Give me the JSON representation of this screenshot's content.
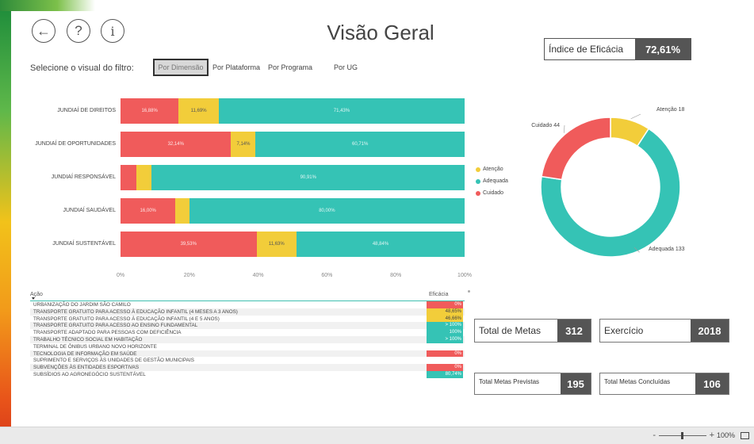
{
  "title": "Visão Geral",
  "nav": {
    "back_icon": "←",
    "help_icon": "?",
    "info_icon": "i"
  },
  "filter": {
    "label": "Selecione o visual do filtro:",
    "options": [
      "Por Dimensão",
      "Por Plataforma",
      "Por Programa",
      "Por UG"
    ],
    "selected": "Por Dimensão"
  },
  "eficacia": {
    "label": "Índice de Eficácia",
    "value": "72,61%"
  },
  "colors": {
    "atencao": "#f2cd3a",
    "adequada": "#35c3b5",
    "cuidado": "#f05b5b"
  },
  "chart_data": [
    {
      "type": "bar",
      "orientation": "horizontal-stacked-100",
      "categories": [
        "JUNDIAÍ DE DIREITOS",
        "JUNDIAÍ DE OPORTUNIDADES",
        "JUNDIAÍ RESPONSÁVEL",
        "JUNDIAÍ SAUDÁVEL",
        "JUNDIAÍ SUSTENTÁVEL"
      ],
      "series": [
        {
          "name": "Cuidado",
          "values": [
            16.88,
            32.14,
            4.55,
            16.0,
            39.53
          ],
          "labels": [
            "16,88%",
            "32,14%",
            "",
            "16,00%",
            "39,53%"
          ]
        },
        {
          "name": "Atenção",
          "values": [
            11.69,
            7.14,
            4.55,
            4.0,
            11.63
          ],
          "labels": [
            "11,69%",
            "7,14%",
            "",
            "",
            "11,63%"
          ]
        },
        {
          "name": "Adequada",
          "values": [
            71.43,
            60.71,
            90.91,
            80.0,
            48.84
          ],
          "labels": [
            "71,43%",
            "60,71%",
            "90,91%",
            "80,00%",
            "48,84%"
          ]
        }
      ],
      "x_ticks": [
        "0%",
        "20%",
        "40%",
        "60%",
        "80%",
        "100%"
      ],
      "xlim": [
        0,
        100
      ],
      "legend": {
        "position": "right",
        "entries": [
          "Atenção",
          "Adequada",
          "Cuidado"
        ]
      }
    },
    {
      "type": "pie",
      "style": "donut",
      "slices": [
        {
          "name": "Atenção",
          "value": 18,
          "label": "Atenção 18"
        },
        {
          "name": "Adequada",
          "value": 133,
          "label": "Adequada 133"
        },
        {
          "name": "Cuidado",
          "value": 44,
          "label": "Cuidado 44"
        }
      ]
    }
  ],
  "table": {
    "col_acao": "Ação",
    "col_eficacia": "Eficácia",
    "rows": [
      {
        "acao": "URBANIZAÇÃO DO JARDIM SÃO CAMILO",
        "eficacia": "0%",
        "status": "cuidado"
      },
      {
        "acao": "TRANSPORTE GRATUITO PARA ACESSO À EDUCAÇÃO INFANTIL (4 MESES A 3 ANOS)",
        "eficacia": "48,65%",
        "status": "atencao"
      },
      {
        "acao": "TRANSPORTE GRATUITO PARA ACESSO À EDUCAÇÃO INFANTIL (4 E 5 ANOS)",
        "eficacia": "46,66%",
        "status": "atencao"
      },
      {
        "acao": "TRANSPORTE GRATUITO PARA ACESSO AO ENSINO FUNDAMENTAL",
        "eficacia": "> 100%",
        "status": "adequada"
      },
      {
        "acao": "TRANSPORTE ADAPTADO PARA PESSOAS COM DEFICIÊNCIA",
        "eficacia": "100%",
        "status": "adequada"
      },
      {
        "acao": "TRABALHO TÉCNICO SOCIAL EM HABITAÇÃO",
        "eficacia": "> 100%",
        "status": "adequada"
      },
      {
        "acao": "TERMINAL DE ÔNIBUS URBANO NOVO HORIZONTE",
        "eficacia": "",
        "status": "none"
      },
      {
        "acao": "TECNOLOGIA DE INFORMAÇÃO EM SAÚDE",
        "eficacia": "0%",
        "status": "cuidado"
      },
      {
        "acao": "SUPRIMENTO E SERVIÇOS ÀS UNIDADES DE GESTÃO MUNICIPAIS",
        "eficacia": "",
        "status": "none"
      },
      {
        "acao": "SUBVENÇÕES ÀS ENTIDADES ESPORTIVAS",
        "eficacia": "0%",
        "status": "cuidado"
      },
      {
        "acao": "SUBSÍDIOS AO AGRONEGÓCIO SUSTENTÁVEL",
        "eficacia": "80,74%",
        "status": "adequada"
      }
    ]
  },
  "kpis": {
    "total_metas": {
      "label": "Total de Metas",
      "value": "312"
    },
    "exercicio": {
      "label": "Exercício",
      "value": "2018"
    },
    "metas_previstas": {
      "label": "Total Metas Previstas",
      "value": "195"
    },
    "metas_concluidas": {
      "label": "Total Metas Concluídas",
      "value": "106"
    }
  },
  "statusbar": {
    "zoom_minus": "-",
    "zoom_plus": "+",
    "zoom": "100%",
    "zoom_level": 0.5
  }
}
